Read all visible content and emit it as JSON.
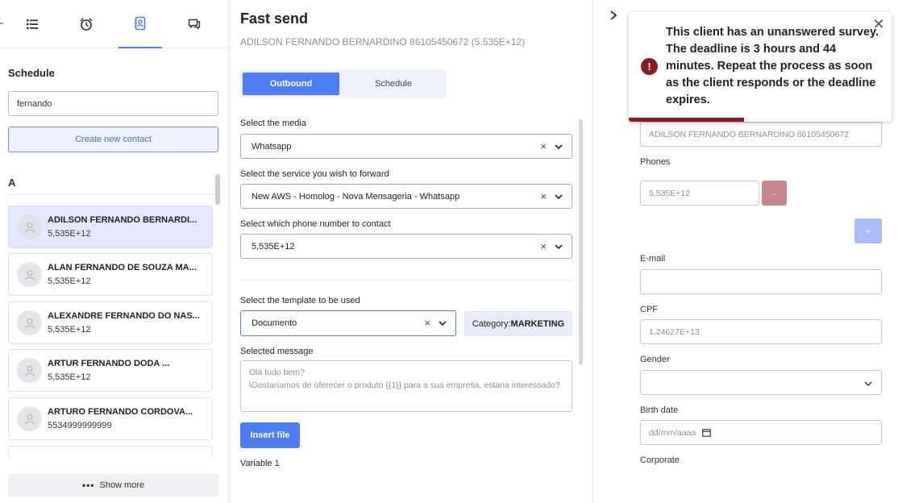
{
  "nav": {
    "items": [
      {
        "icon": "list-icon",
        "active": false
      },
      {
        "icon": "alarm-clock-icon",
        "active": false
      },
      {
        "icon": "contact-book-icon",
        "active": true
      },
      {
        "icon": "chat-bubbles-icon",
        "active": false
      }
    ]
  },
  "schedule": {
    "title": "Schedule",
    "search_value": "fernando",
    "create_label": "Create new contact",
    "section_letter": "A",
    "contacts": [
      {
        "name": "ADILSON FERNANDO BERNARDI...",
        "phone": "5,535E+12",
        "selected": true
      },
      {
        "name": "ALAN FERNANDO DE SOUZA MA...",
        "phone": "5,535E+12",
        "selected": false
      },
      {
        "name": "ALEXANDRE FERNANDO DO NAS...",
        "phone": "5,535E+12",
        "selected": false
      },
      {
        "name": "ARTUR FERNANDO DODA ...",
        "phone": "5,535E+12",
        "selected": false
      },
      {
        "name": "ARTURO FERNANDO CORDOVA...",
        "phone": "5534999999999",
        "selected": false
      }
    ],
    "show_more_label": "Show more"
  },
  "fast_send": {
    "title": "Fast send",
    "subtitle": "ADILSON FERNANDO BERNARDINO 86105450672 (5,535E+12)",
    "tabs": {
      "outbound": "Outbound",
      "schedule": "Schedule"
    },
    "media_label": "Select the media",
    "media_value": "Whatsapp",
    "service_label": "Select the service you wish to forward",
    "service_value": "New AWS - Homolog - Nova Mensageria - Whatsapp",
    "phone_label": "Select which phone number to contact",
    "phone_value": "5,535E+12",
    "template_label": "Select the template to be used",
    "template_value": "Documento",
    "category_prefix": "Category:",
    "category_value": "MARKETING",
    "selected_message_label": "Selected message",
    "selected_message": "Olá tudo bem?\n\\Gostaríamos de oferecer o produto {{1}} para a sua empresa, estaria interessado?",
    "insert_file_label": "Insert file",
    "variable_label": "Variable 1"
  },
  "contact_form": {
    "name_value": "ADILSON FERNANDO BERNARDINO 86105450672",
    "phones_label": "Phones",
    "phone_value": "5,535E+12",
    "remove_label": "-",
    "add_label": "+",
    "email_label": "E-mail",
    "email_value": "",
    "cpf_label": "CPF",
    "cpf_value": "1,24627E+13",
    "gender_label": "Gender",
    "gender_value": "",
    "birth_label": "Birth date",
    "birth_placeholder": "dd/mm/aaaa",
    "corporate_label": "Corporate"
  },
  "toast": {
    "message": "This client has an unanswered survey. The deadline is 3 hours and 44 minutes. Repeat the process as soon as the client responds or the deadline expires.",
    "icon_glyph": "!",
    "close_glyph": "✕",
    "progress": 0.44,
    "color": "#8b1a22"
  },
  "colors": {
    "accent": "#4e7cf6",
    "danger": "#8b1a22"
  }
}
